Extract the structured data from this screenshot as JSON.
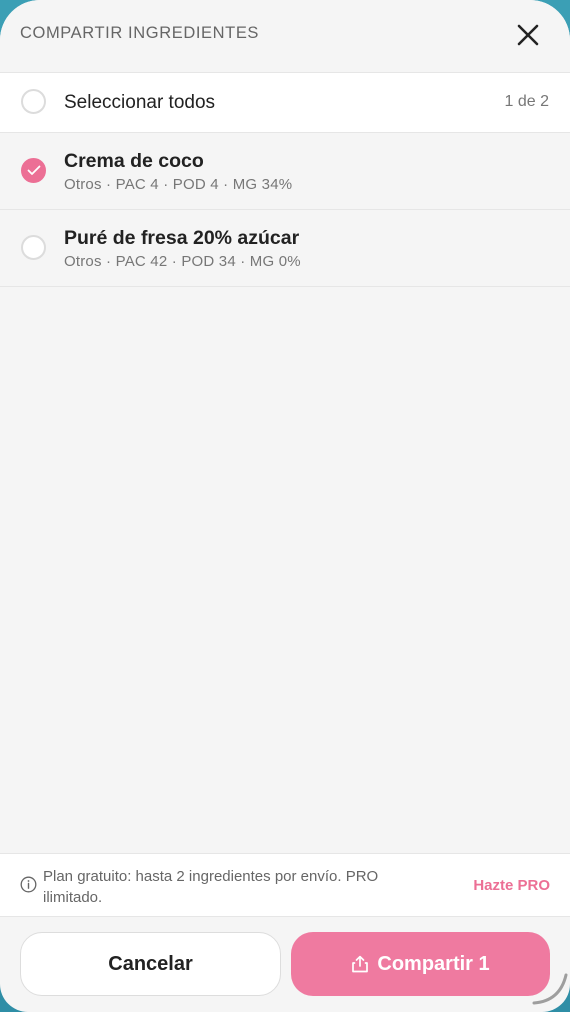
{
  "header": {
    "title": "COMPARTIR INGREDIENTES",
    "close_icon": "close-icon"
  },
  "select_all": {
    "label": "Seleccionar todos",
    "count": "1 de 2",
    "checked": false
  },
  "items": [
    {
      "name": "Crema de coco",
      "meta": "Otros · PAC 4 · POD 4 · MG 34%",
      "checked": true
    },
    {
      "name": "Puré de fresa 20% azúcar",
      "meta": "Otros · PAC 42 · POD 34 · MG 0%",
      "checked": false
    }
  ],
  "plan": {
    "icon": "info-icon",
    "text": "Plan gratuito: hasta 2 ingredientes por envío. PRO ilimitado.",
    "link": "Hazte PRO"
  },
  "footer": {
    "cancel_label": "Cancelar",
    "share_label": "Compartir 1",
    "share_icon": "share-icon"
  },
  "colors": {
    "accent": "#ec6f95",
    "share_button": "#ef7aa0"
  }
}
